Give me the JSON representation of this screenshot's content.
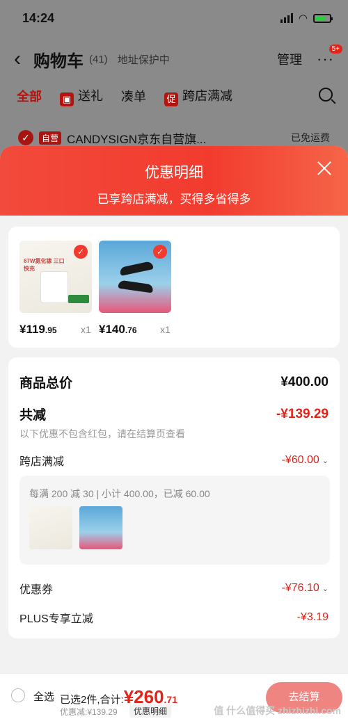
{
  "status": {
    "time": "14:24"
  },
  "cart": {
    "title": "购物车",
    "count": "(41)",
    "address": "地址保护中",
    "manage": "管理",
    "more_badge": "5+",
    "tabs": [
      "全部",
      "送礼",
      "凑单",
      "跨店满减"
    ],
    "shop_name": "CANDYSIGN京东自营旗...",
    "self_tag": "自营",
    "shop_shipping": "已免运费"
  },
  "sheet": {
    "title": "优惠明细",
    "subtitle": "已享跨店满减，买得多省得多",
    "products": [
      {
        "name": "67W氮化镓 三口快充",
        "price_int": "¥119",
        "price_dec": ".95",
        "qty": "x1"
      },
      {
        "name": "361 运动鞋",
        "price_int": "¥140",
        "price_dec": ".76",
        "qty": "x1"
      }
    ],
    "total_label": "商品总价",
    "total_value": "¥400.00",
    "reduce_label": "共减",
    "reduce_value": "-¥139.29",
    "note": "以下优惠不包含红包，请在结算页查看",
    "cross_label": "跨店满减",
    "cross_value": "-¥60.00",
    "cross_detail": "每满 200 减 30 | 小计 400.00，已减 60.00",
    "coupon_label": "优惠券",
    "coupon_value": "-¥76.10",
    "plus_label": "PLUS专享立减",
    "plus_value": "-¥3.19"
  },
  "bottom": {
    "select_all": "全选",
    "selected_prefix": "已选2件,合计:",
    "total_int": "¥260",
    "total_dec": ".71",
    "discount_line": "优惠减:¥139.29",
    "detail_btn": "优惠明细",
    "checkout": "去结算"
  },
  "watermark": "值 什么值得买 zhizhizhi.com",
  "colors": {
    "accent": "#e2231a",
    "sheet_header": "#f23b2e"
  }
}
